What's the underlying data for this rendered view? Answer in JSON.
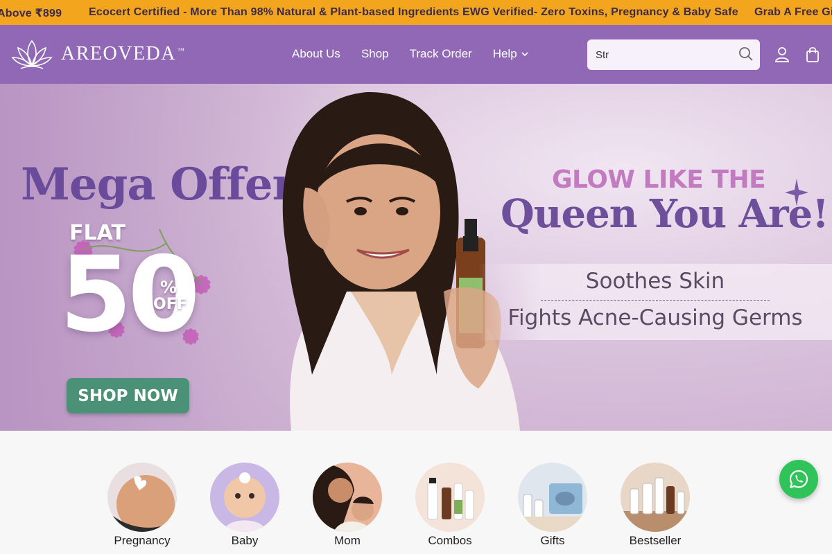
{
  "announcement": {
    "left_fragment": "Above ₹899",
    "main": "Ecocert Certified - More Than 98% Natural & Plant-based Ingredients EWG Verified- Zero Toxins, Pregnancy & Baby Safe",
    "right_fragment": "Grab A Free Gi"
  },
  "header": {
    "logo_text": "AREOVEDA",
    "logo_tm": "™",
    "nav": [
      "About Us",
      "Shop",
      "Track Order",
      "Help"
    ],
    "search": {
      "value": "Str"
    },
    "icons": [
      "search-icon",
      "account-icon",
      "bag-icon"
    ]
  },
  "hero": {
    "mega": "Mega Offer",
    "flat": "FLAT",
    "fifty": "50",
    "percent": "%",
    "off": "OFF",
    "cta": "SHOP NOW",
    "glow": "GLOW LIKE THE",
    "queen": "Queen You Are!",
    "benefit_1": "Soothes Skin",
    "benefit_2": "Fights Acne-Causing Germs"
  },
  "categories": [
    {
      "label": "Pregnancy"
    },
    {
      "label": "Baby"
    },
    {
      "label": "Mom"
    },
    {
      "label": "Combos"
    },
    {
      "label": "Gifts"
    },
    {
      "label": "Bestseller"
    }
  ],
  "colors": {
    "announcement_bg": "#f3a51e",
    "header_bg": "#9068b6",
    "cta_bg": "#4b9178",
    "whatsapp": "#2fc35a"
  }
}
